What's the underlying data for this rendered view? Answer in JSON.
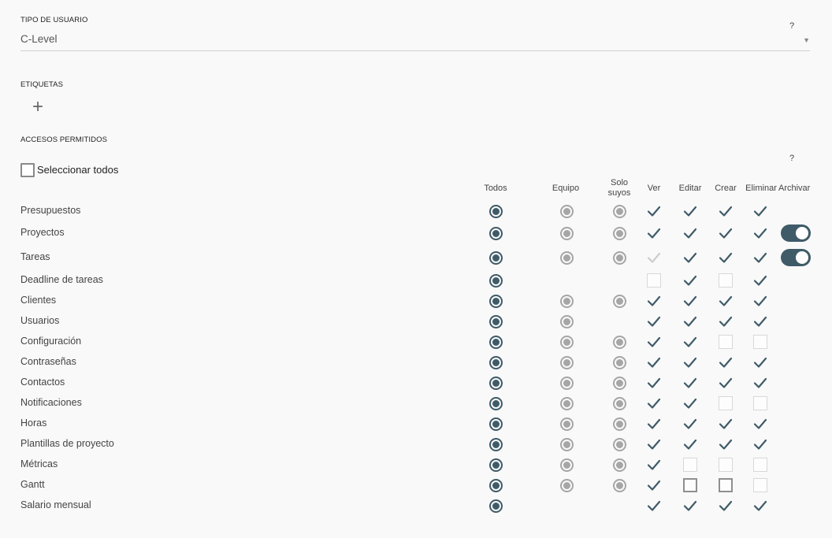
{
  "user_type": {
    "label": "TIPO DE USUARIO",
    "value": "C-Level",
    "help": "?"
  },
  "tags": {
    "label": "ETIQUETAS",
    "add_symbol": "+"
  },
  "access": {
    "label": "ACCESOS PERMITIDOS",
    "help": "?",
    "select_all_label": "Seleccionar todos",
    "columns": {
      "todos": "Todos",
      "equipo": "Equipo",
      "solo_suyos": "Solo suyos",
      "ver": "Ver",
      "editar": "Editar",
      "crear": "Crear",
      "eliminar": "Eliminar",
      "archivar": "Archivar"
    },
    "rows": [
      {
        "label": "Presupuestos",
        "todos": "on",
        "equipo": "off",
        "solo": "off",
        "ver": "check",
        "editar": "check",
        "crear": "check",
        "eliminar": "check",
        "archivar": "none"
      },
      {
        "label": "Proyectos",
        "todos": "on",
        "equipo": "off",
        "solo": "off",
        "ver": "check",
        "editar": "check",
        "crear": "check",
        "eliminar": "check",
        "archivar": "toggle"
      },
      {
        "label": "Tareas",
        "todos": "on",
        "equipo": "off",
        "solo": "off",
        "ver": "check-light",
        "editar": "check",
        "crear": "check",
        "eliminar": "check",
        "archivar": "toggle"
      },
      {
        "label": "Deadline de tareas",
        "todos": "on",
        "equipo": "none",
        "solo": "none",
        "ver": "box",
        "editar": "check",
        "crear": "box",
        "eliminar": "check",
        "archivar": "none"
      },
      {
        "label": "Clientes",
        "todos": "on",
        "equipo": "off",
        "solo": "off",
        "ver": "check",
        "editar": "check",
        "crear": "check",
        "eliminar": "check",
        "archivar": "none"
      },
      {
        "label": "Usuarios",
        "todos": "on",
        "equipo": "off",
        "solo": "none",
        "ver": "check",
        "editar": "check",
        "crear": "check",
        "eliminar": "check",
        "archivar": "none"
      },
      {
        "label": "Configuración",
        "todos": "on",
        "equipo": "off",
        "solo": "off",
        "ver": "check",
        "editar": "check",
        "crear": "box",
        "eliminar": "box",
        "archivar": "none"
      },
      {
        "label": "Contraseñas",
        "todos": "on",
        "equipo": "off",
        "solo": "off",
        "ver": "check",
        "editar": "check",
        "crear": "check",
        "eliminar": "check",
        "archivar": "none"
      },
      {
        "label": "Contactos",
        "todos": "on",
        "equipo": "off",
        "solo": "off",
        "ver": "check",
        "editar": "check",
        "crear": "check",
        "eliminar": "check",
        "archivar": "none"
      },
      {
        "label": "Notificaciones",
        "todos": "on",
        "equipo": "off",
        "solo": "off",
        "ver": "check",
        "editar": "check",
        "crear": "box",
        "eliminar": "box",
        "archivar": "none"
      },
      {
        "label": "Horas",
        "todos": "on",
        "equipo": "off",
        "solo": "off",
        "ver": "check",
        "editar": "check",
        "crear": "check",
        "eliminar": "check",
        "archivar": "none"
      },
      {
        "label": "Plantillas de proyecto",
        "todos": "on",
        "equipo": "off",
        "solo": "off",
        "ver": "check",
        "editar": "check",
        "crear": "check",
        "eliminar": "check",
        "archivar": "none"
      },
      {
        "label": "Métricas",
        "todos": "on",
        "equipo": "off",
        "solo": "off",
        "ver": "check",
        "editar": "box",
        "crear": "box",
        "eliminar": "box",
        "archivar": "none"
      },
      {
        "label": "Gantt",
        "todos": "on",
        "equipo": "off",
        "solo": "off",
        "ver": "check",
        "editar": "box-dark",
        "crear": "box-dark",
        "eliminar": "box",
        "archivar": "none"
      },
      {
        "label": "Salario mensual",
        "todos": "on",
        "equipo": "none",
        "solo": "none",
        "ver": "check",
        "editar": "check",
        "crear": "check",
        "eliminar": "check",
        "archivar": "none"
      }
    ]
  },
  "colors": {
    "accent": "#3f5b68",
    "radio_off": "#a6a6a6",
    "check_light": "#cccccc",
    "background": "#f9f9f9"
  }
}
